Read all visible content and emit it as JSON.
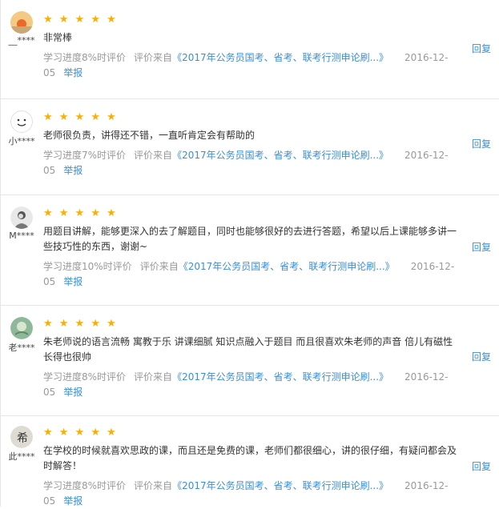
{
  "reviews": [
    {
      "avatar": "sunset-avatar",
      "user": "__****",
      "stars": "★ ★ ★ ★ ★",
      "text": "非常棒",
      "progress": "学习进度8%时评价",
      "source_prefix": "评价来自",
      "source_link": "《2017年公务员国考、省考、联考行测申论刷...》",
      "date": "2016-12-05",
      "report": "举报",
      "reply": "回复"
    },
    {
      "avatar": "smiley-avatar",
      "user": "小****",
      "stars": "★ ★ ★ ★ ★",
      "text": "老师很负责，讲得还不错，一直听肯定会有帮助的",
      "progress": "学习进度7%时评价",
      "source_prefix": "评价来自",
      "source_link": "《2017年公务员国考、省考、联考行测申论刷...》",
      "date": "2016-12-05",
      "report": "举报",
      "reply": "回复"
    },
    {
      "avatar": "portrait-avatar",
      "user": "M****",
      "stars": "★ ★ ★ ★ ★",
      "text": "用题目讲解，能够更深入的去了解题目，同时也能够很好的去进行答题，希望以后上课能够多讲一些技巧性的东西，谢谢~",
      "progress": "学习进度10%时评价",
      "source_prefix": "评价来自",
      "source_link": "《2017年公务员国考、省考、联考行测申论刷...》",
      "date": "2016-12-05",
      "report": "举报",
      "reply": "回复"
    },
    {
      "avatar": "nature-avatar",
      "user": "老****",
      "stars": "★ ★ ★ ★ ★",
      "text": "朱老师说的语言流畅 寓教于乐 讲课细腻 知识点融入于题目 而且很喜欢朱老师的声音 倍儿有磁性 长得也很帅",
      "progress": "学习进度8%时评价",
      "source_prefix": "评价来自",
      "source_link": "《2017年公务员国考、省考、联考行测申论刷...》",
      "date": "2016-12-05",
      "report": "举报",
      "reply": "回复"
    },
    {
      "avatar": "calligraphy-avatar",
      "user": "此****",
      "stars": "★ ★ ★ ★ ★",
      "text": "在学校的时候就喜欢思政的课，而且还是免费的课，老师们都很细心，讲的很仔细，有疑问都会及时解答！",
      "progress": "学习进度8%时评价",
      "source_prefix": "评价来自",
      "source_link": "《2017年公务员国考、省考、联考行测申论刷...》",
      "date": "2016-12-05",
      "report": "举报",
      "reply": "回复"
    }
  ],
  "colors": {
    "star": "#ffae00",
    "link": "#3a8fd6",
    "meta": "#999999"
  }
}
